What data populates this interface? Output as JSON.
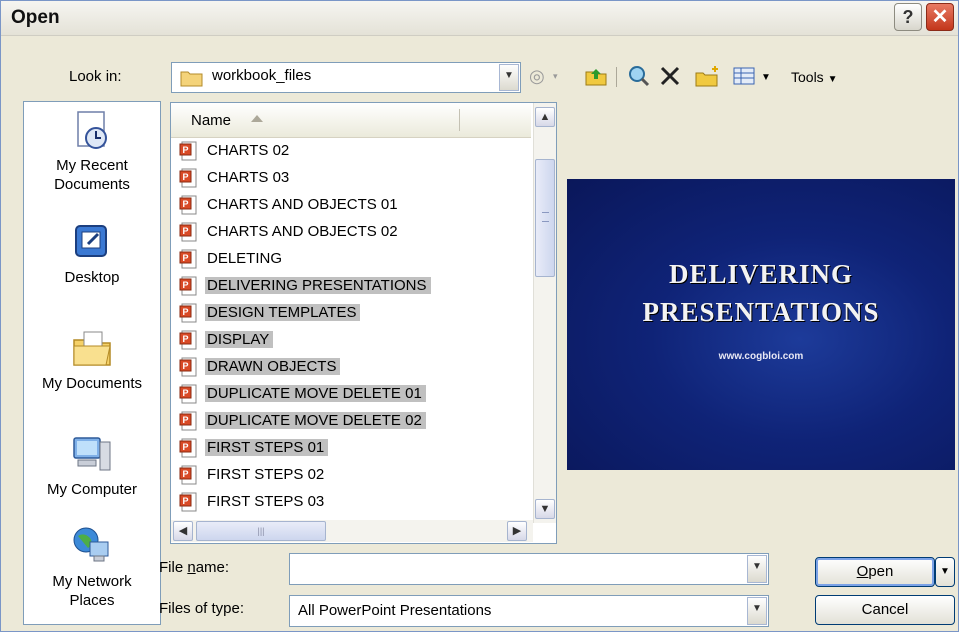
{
  "window": {
    "title": "Open",
    "help_glyph": "?",
    "close_glyph": "✕"
  },
  "lookin": {
    "label": "Look in:",
    "folder": "workbook_files"
  },
  "toolbar": {
    "tools_label": "Tools",
    "icons": [
      "back-icon",
      "up-folder-icon",
      "search-web-icon",
      "delete-icon",
      "new-folder-icon",
      "views-icon"
    ]
  },
  "places": [
    {
      "label": "My Recent Documents",
      "icon": "recent-documents-icon"
    },
    {
      "label": "Desktop",
      "icon": "desktop-icon"
    },
    {
      "label": "My Documents",
      "icon": "my-documents-icon"
    },
    {
      "label": "My Computer",
      "icon": "my-computer-icon"
    },
    {
      "label": "My Network Places",
      "icon": "network-places-icon"
    }
  ],
  "filelist": {
    "column_name": "Name",
    "files": [
      {
        "name": "CHARTS 02",
        "selected": false
      },
      {
        "name": "CHARTS 03",
        "selected": false
      },
      {
        "name": "CHARTS AND OBJECTS 01",
        "selected": false
      },
      {
        "name": "CHARTS AND OBJECTS 02",
        "selected": false
      },
      {
        "name": "DELETING",
        "selected": false
      },
      {
        "name": "DELIVERING PRESENTATIONS",
        "selected": true
      },
      {
        "name": "DESIGN TEMPLATES",
        "selected": true
      },
      {
        "name": "DISPLAY",
        "selected": true
      },
      {
        "name": "DRAWN OBJECTS",
        "selected": true
      },
      {
        "name": "DUPLICATE MOVE DELETE 01",
        "selected": true
      },
      {
        "name": "DUPLICATE MOVE DELETE 02",
        "selected": true
      },
      {
        "name": "FIRST STEPS 01",
        "selected": true
      },
      {
        "name": "FIRST STEPS 02",
        "selected": false
      },
      {
        "name": "FIRST STEPS 03",
        "selected": false
      }
    ]
  },
  "preview": {
    "line1": "DELIVERING",
    "line2": "PRESENTATIONS",
    "url": "www.cogbloi.com"
  },
  "filename": {
    "label_pre": "File ",
    "label_u": "n",
    "label_post": "ame:",
    "value": ""
  },
  "filetype": {
    "label": "Files of type:",
    "value": "All PowerPoint Presentations"
  },
  "buttons": {
    "open_u": "O",
    "open_rest": "pen",
    "cancel": "Cancel"
  },
  "colors": {
    "selection": "#c0c0c0",
    "preview_bg": "#0f2377",
    "border": "#7f9db9"
  }
}
